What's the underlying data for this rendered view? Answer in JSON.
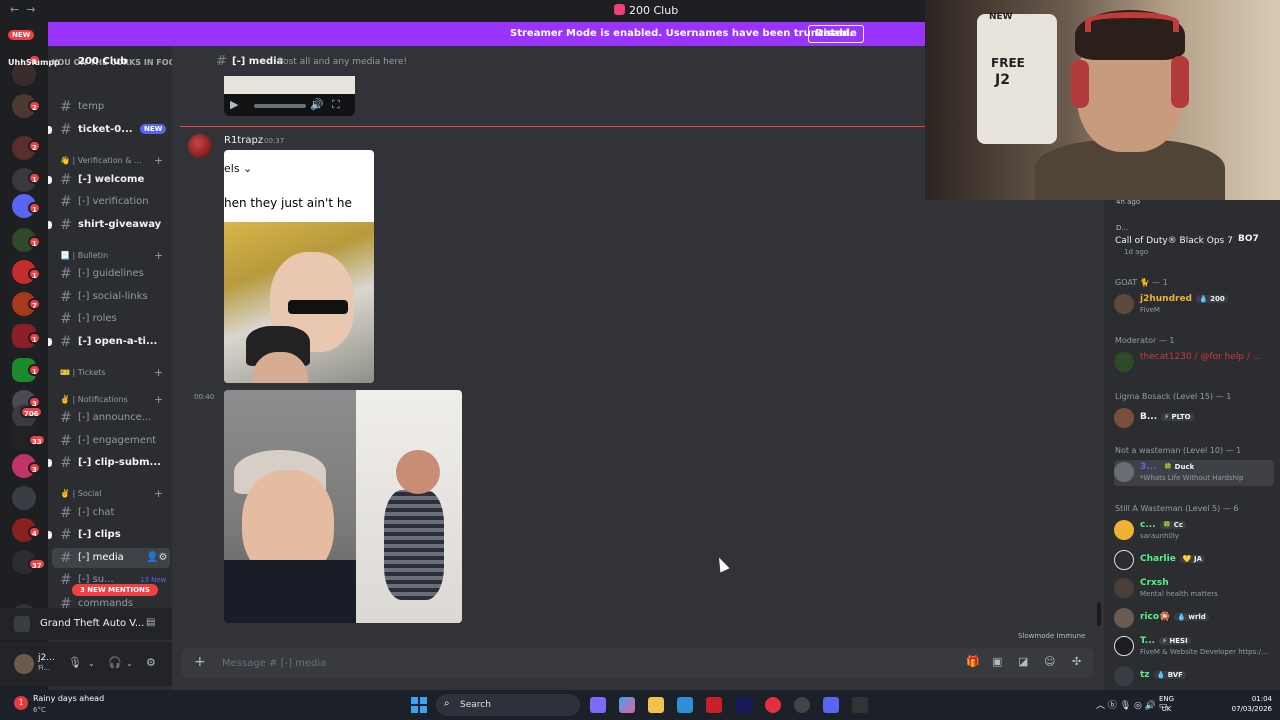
{
  "window": {
    "title": "200 Club",
    "nav_back": "←",
    "nav_forward": "→"
  },
  "banner": {
    "text": "Streamer Mode is enabled. Usernames have been truncated.",
    "button": "Disable"
  },
  "rail": {
    "new_label": "NEW",
    "overlay_text": "UhhSlumpp",
    "badges": [
      "1",
      "2",
      "2",
      "1",
      "1",
      "1",
      "1",
      "7",
      "1",
      "1",
      "3",
      "706",
      "33",
      "3",
      "4",
      "37"
    ],
    "add": "+"
  },
  "sidebar": {
    "server_name": "200 Club",
    "overlay": "YOU ON THE CORKS IN FOGO CORKEY",
    "channels": [
      {
        "name": "temp",
        "prefix": "#"
      },
      {
        "name": "ticket-0...",
        "prefix": "#",
        "badge": "NEW"
      },
      {
        "name": "[-] welcome",
        "prefix": "#"
      },
      {
        "name": "[-] verification",
        "prefix": "#"
      },
      {
        "name": "shirt-giveaway",
        "prefix": "#"
      },
      {
        "name": "[-] guidelines",
        "prefix": "#"
      },
      {
        "name": "[-] social-links",
        "prefix": "#"
      },
      {
        "name": "[-] roles",
        "prefix": "#"
      },
      {
        "name": "[-] open-a-ti...",
        "prefix": "#"
      },
      {
        "name": "[-] announce...",
        "prefix": "#"
      },
      {
        "name": "[-] engagement",
        "prefix": "#"
      },
      {
        "name": "[-] clip-subm...",
        "prefix": "#"
      },
      {
        "name": "[-] chat",
        "prefix": "#"
      },
      {
        "name": "[-] clips",
        "prefix": "#"
      },
      {
        "name": "[-] media",
        "prefix": "#"
      },
      {
        "name": "[-] su...",
        "prefix": "#"
      },
      {
        "name": "commands",
        "prefix": "#"
      }
    ],
    "categories": [
      "👋 | Verification & ...",
      "📃 | Bulletin",
      "🎫 | Tickets",
      "✌️ | Notifications",
      "✌️ | Social"
    ],
    "new_count": "13 New",
    "mentions": "3 NEW MENTIONS"
  },
  "activity": {
    "label": "Grand Theft Auto V..."
  },
  "user": {
    "name": "j2...",
    "status": "Fi..."
  },
  "channel_header": {
    "name": "[-] media",
    "topic": "Post all and any media here!"
  },
  "messages": {
    "author": "R1trapz",
    "time1": "00:37",
    "time2": "00:40",
    "video1_caption_top": "els ⌄",
    "video1_caption": "hen they just ain't he"
  },
  "slowmode": "Slowmode Immune",
  "composer": {
    "placeholder": "Message # [-] media"
  },
  "webcam": {
    "jersey_name": "FREE",
    "jersey_id": "J2",
    "jersey_top": "NEW"
  },
  "members": {
    "activity_time": "4h ago",
    "activity_user": "D...",
    "activity_game": "Call of Duty® Black Ops 7",
    "activity_ago": "1d ago",
    "bo7": "BO7",
    "groups": [
      {
        "title": "GOAT 🐈 — 1",
        "members": [
          {
            "name": "j2hundred",
            "tag": "💧 200",
            "status": "FiveM",
            "color": "#f0b232"
          }
        ]
      },
      {
        "title": "Moderator — 1",
        "members": [
          {
            "name": "thecat1230 / @for help / ...",
            "tag": "",
            "status": "",
            "color": "#c83a3a"
          }
        ]
      },
      {
        "title": "Ligma Bosack (Level 15) — 1",
        "members": [
          {
            "name": "B...",
            "tag": "⚡ PLTO",
            "status": "",
            "color": "#f2f3f5"
          }
        ]
      },
      {
        "title": "Not a wasteman (Level 10) — 1",
        "members": [
          {
            "name": "3...",
            "tag": "🍀 Duck",
            "status": "*Whats Life Without Hardship",
            "color": "#5865f2"
          }
        ]
      },
      {
        "title": "Still A Wasteman (Level 5) — 6",
        "members": [
          {
            "name": "c...",
            "tag": "🍀 Cc",
            "status": "saraunh0ly",
            "color": "#57f287"
          },
          {
            "name": "Charlie",
            "tag": "💛 JA",
            "status": "",
            "color": "#57f287"
          },
          {
            "name": "Crxsh",
            "tag": "",
            "status": "Mental health matters",
            "color": "#57f287"
          },
          {
            "name": "rico🎇",
            "tag": "💧 wrld",
            "status": "",
            "color": "#57f287"
          },
          {
            "name": "T...",
            "tag": "⚡ HESI",
            "status": "FiveM & Website Developer https:/...",
            "color": "#57f287"
          },
          {
            "name": "tz",
            "tag": "💧 BVF",
            "status": "",
            "color": "#57f287"
          }
        ]
      }
    ]
  },
  "taskbar": {
    "weather": "Rainy days ahead",
    "temp": "6°C",
    "weather_badge": "1",
    "search": "Search",
    "lang1": "ENG",
    "lang2": "UK",
    "time": "01:04",
    "date": "07/03/2026"
  }
}
